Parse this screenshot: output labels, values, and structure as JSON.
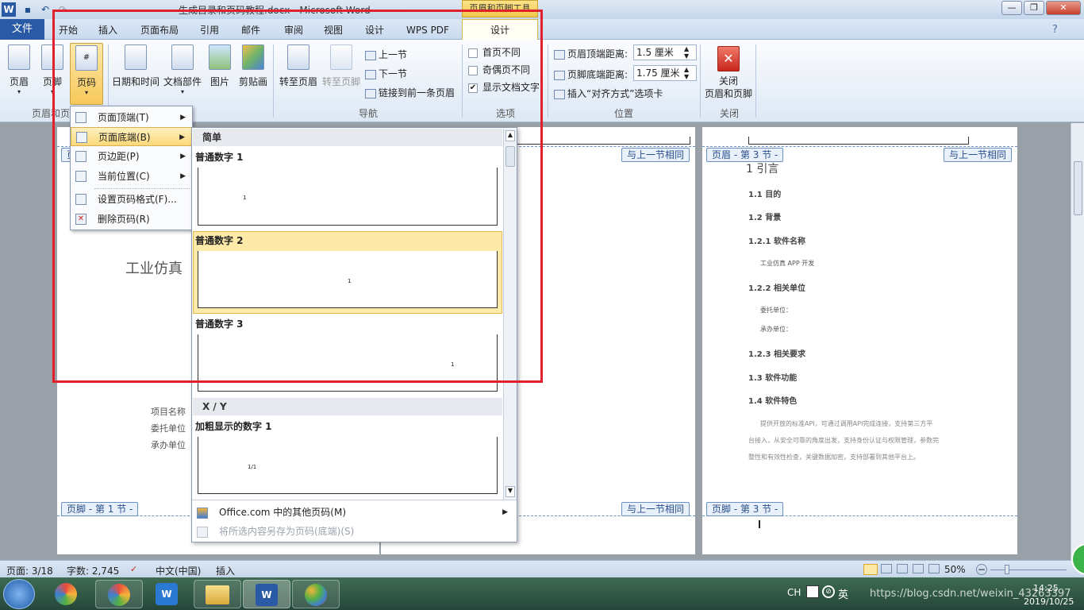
{
  "window": {
    "title": "生成目录和页码教程.docx - Microsoft Word",
    "context_tab_group": "页眉和页脚工具"
  },
  "tabs": [
    "开始",
    "插入",
    "页面布局",
    "引用",
    "邮件",
    "审阅",
    "视图",
    "设计",
    "WPS PDF"
  ],
  "file_tab": "文件",
  "active_tab": "设计",
  "ribbon": {
    "group1": {
      "buttons": [
        "页眉",
        "页脚",
        "页码"
      ],
      "label": "页眉和页脚"
    },
    "group2": {
      "buttons": [
        "日期和时间",
        "文档部件",
        "图片",
        "剪贴画"
      ],
      "label": "插入"
    },
    "nav": {
      "buttons": [
        "转至页眉",
        "转至页脚"
      ],
      "small": [
        "上一节",
        "下一节",
        "链接到前一条页眉"
      ],
      "label": "导航"
    },
    "options": {
      "items": [
        {
          "label": "首页不同",
          "checked": false
        },
        {
          "label": "奇偶页不同",
          "checked": false
        },
        {
          "label": "显示文档文字",
          "checked": true
        }
      ],
      "label": "选项"
    },
    "position": {
      "header_label": "页眉顶端距离:",
      "header_value": "1.5 厘米",
      "footer_label": "页脚底端距离:",
      "footer_value": "1.75 厘米",
      "insert_tab": "插入“对齐方式”选项卡",
      "label": "位置"
    },
    "close": {
      "button": "关闭\n页眉和页脚",
      "label": "关闭"
    }
  },
  "page_number_menu": {
    "items": [
      {
        "label": "页面顶端(T)",
        "submenu": true
      },
      {
        "label": "页面底端(B)",
        "submenu": true,
        "highlighted": true
      },
      {
        "label": "页边距(P)",
        "submenu": true
      },
      {
        "label": "当前位置(C)",
        "submenu": true
      },
      {
        "label": "设置页码格式(F)...",
        "submenu": false
      },
      {
        "label": "删除页码(R)",
        "submenu": false
      }
    ]
  },
  "gallery": {
    "section1": "简单",
    "items": [
      {
        "name": "普通数字 1",
        "sample": "1"
      },
      {
        "name": "普通数字 2",
        "sample": "1",
        "selected": true
      },
      {
        "name": "普通数字 3",
        "sample": "1"
      }
    ],
    "section2": "X / Y",
    "items2": [
      {
        "name": "加粗显示的数字 1",
        "sample": "1/1"
      }
    ],
    "footer_more": "Office.com 中的其他页码(M)",
    "footer_save": "将所选内容另存为页码(底端)(S)"
  },
  "document": {
    "page1": {
      "title": "工业仿真",
      "fields": [
        "项目名称",
        "委托单位",
        "承办单位"
      ],
      "footer_tag": "页脚 - 第 1 节 -",
      "header_tag": "页"
    },
    "page2": {
      "same_as_prev": "与上一节相同"
    },
    "page3": {
      "header_tag": "页眉 - 第 3 节 -",
      "same_as_prev": "与上一节相同",
      "footer_tag": "页脚 - 第 3 节 -",
      "heading": "1 引言",
      "toc": [
        "1.1 目的",
        "1.2 背景",
        "1.2.1 软件名称",
        "1.2.2 相关单位",
        "1.2.3 相关要求",
        "1.3 软件功能",
        "1.4 软件特色"
      ],
      "sub_name": "工业仿真 APP 开发",
      "sub_units": [
        "委托单位：",
        "承办单位："
      ],
      "para": [
        "提供开放的标准API，可通过调用API完成连接，支持第三方平",
        "台接入，从安全可靠的角度出发，支持身份认证与权限管理，参数完",
        "整性和有效性检查，关键数据加密，支持部署到其他平台上。"
      ]
    }
  },
  "statusbar": {
    "page": "页面: 3/18",
    "words": "字数: 2,745",
    "lang": "中文(中国)",
    "mode": "插入",
    "zoom": "50%"
  },
  "taskbar": {
    "lang": "CH",
    "ime": "英",
    "time": "14:25",
    "date": "2019/10/25",
    "watermark": "https://blog.csdn.net/weixin_43263397"
  }
}
